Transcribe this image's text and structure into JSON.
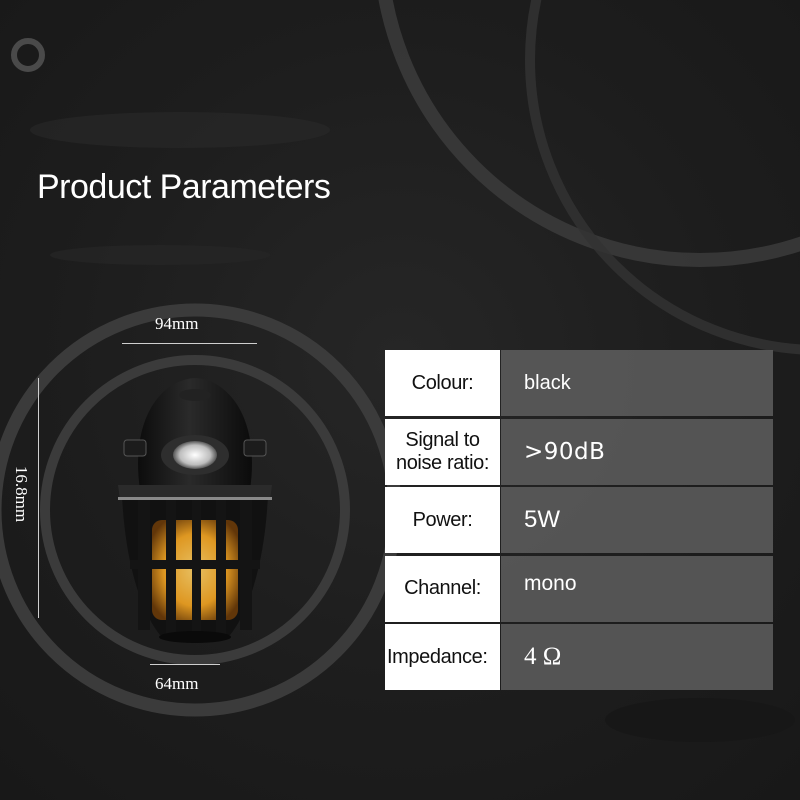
{
  "title": "Product Parameters",
  "dimensions": {
    "width_top": "94mm",
    "width_bottom": "64mm",
    "height": "16.8mm"
  },
  "parameters": [
    {
      "label": "Colour:",
      "value": "black"
    },
    {
      "label": "Signal to noise ratio:",
      "value": ">90dB"
    },
    {
      "label": "Power:",
      "value": "5W"
    },
    {
      "label": "Channel:",
      "value": "mono"
    },
    {
      "label": "Impedance:",
      "value": "4 Ω"
    }
  ],
  "colors": {
    "background": "#1f1f1f",
    "ring": "#3a3a3a",
    "label_cell": "#ffffff",
    "value_cell": "#5c5c5c",
    "flame": "#f5a623"
  }
}
